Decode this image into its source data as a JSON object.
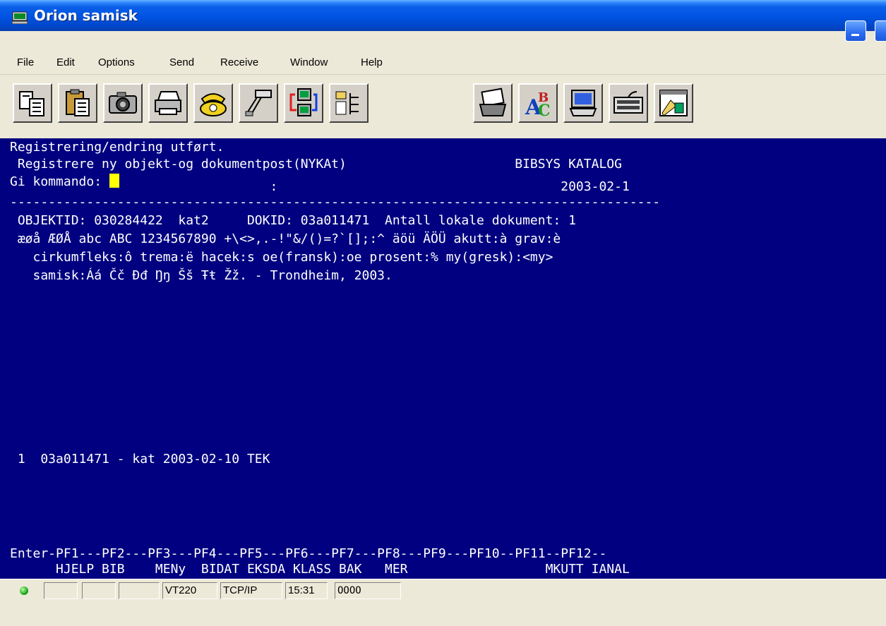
{
  "window": {
    "title": "Orion samisk"
  },
  "menu": [
    "File",
    "Edit",
    "Options",
    "Send",
    "Receive",
    "Window",
    "Help"
  ],
  "toolbar": {
    "icons": [
      "copy-icon",
      "paste-icon",
      "camera-icon",
      "print-icon",
      "phone-icon",
      "hangup-icon",
      "network-transfer-icon",
      "file-tree-icon",
      "card-file-icon",
      "spell-check-icon",
      "monitor-icon",
      "keyboard-icon",
      "window-icon"
    ]
  },
  "terminal": {
    "lines": [
      "Registrering/endring utført.",
      " Registrere ny objekt-og dokumentpost(NYKAt)                      BIBSYS KATALOG",
      "Gi kommando:",
      "                                  :                                     2003-02-1",
      "-------------------------------------------------------------------------------------",
      " OBJEKTID: 030284422  kat2     DOKID: 03a011471  Antall lokale dokument: 1",
      " æøå ÆØÅ abc ABC 1234567890 +\\<>,.-!\"&/()=?`[];:^ äöü ÄÖÜ akutt:à grav:è",
      "   cirkumfleks:ô trema:ë hacek:s oe(fransk):oe prosent:% my(gresk):<my>",
      "   samisk:Áá Čč Đđ Ŋŋ Šš Ŧŧ Žž. - Trondheim, 2003.",
      " 1  03a011471 - kat 2003-02-10 TEK",
      "Enter-PF1---PF2---PF3---PF4---PF5---PF6---PF7---PF8---PF9---PF10--PF11--PF12--",
      "      HJELP BIB    MENy  BIDAT EKSDA KLASS BAK   MER                  MKUTT IANAL"
    ],
    "cursor_color": "#ffff00",
    "background": "#000080",
    "foreground": "#ffffff"
  },
  "statusbar": {
    "terminal_type": "VT220",
    "protocol": "TCP/IP",
    "time": "15:31",
    "indicator": "OOOO",
    "led_color": "#0a9a10"
  }
}
